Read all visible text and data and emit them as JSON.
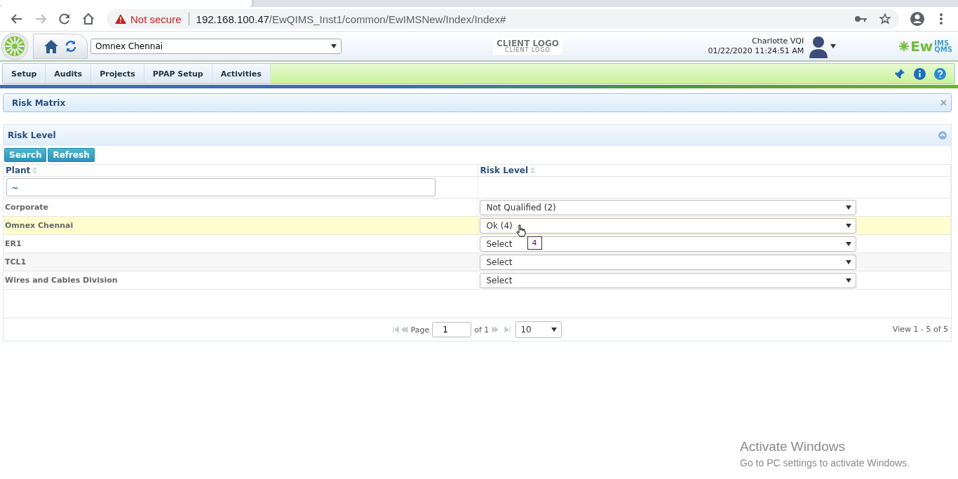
{
  "browser": {
    "security": "Not secure",
    "url_host": "192.168.100.47",
    "url_path": "/EwQIMS_Inst1/common/EwIMSNew/Index/Index#"
  },
  "header": {
    "plant": "Omnex Chennai",
    "client_logo": "CLIENT LOGO",
    "client_logo_sub": "CLIENT LOGO",
    "user": "Charlotte VQI",
    "datetime": "01/22/2020 11:24:51 AM",
    "brand": "Ew",
    "brand_sup": "IMS",
    "brand_sub": "QMS"
  },
  "nav": [
    {
      "label": "Setup"
    },
    {
      "label": "Audits"
    },
    {
      "label": "Projects"
    },
    {
      "label": "PPAP Setup"
    },
    {
      "label": "Activities"
    }
  ],
  "page_title": "Risk Matrix",
  "panel": {
    "title": "Risk Level",
    "buttons": [
      "Search",
      "Refresh"
    ],
    "columns": [
      "Plant",
      "Risk Level"
    ],
    "filter_value": "~",
    "rows": [
      {
        "plant": "Corporate",
        "risk": "Not Qualified (2)",
        "selected": false
      },
      {
        "plant": "Omnex Chennai",
        "risk": "Ok (4)",
        "selected": true
      },
      {
        "plant": "ER1",
        "risk": "Select",
        "selected": false
      },
      {
        "plant": "TCL1",
        "risk": "Select",
        "selected": false
      },
      {
        "plant": "Wires and Cables Division",
        "risk": "Select",
        "selected": false
      }
    ],
    "tooltip": "4",
    "pager": {
      "page_label": "Page",
      "page": "1",
      "of": "of 1",
      "page_size": "10",
      "view": "View 1 - 5 of 5"
    }
  },
  "os_notice": {
    "title": "Activate Windows",
    "text": "Go to PC settings to activate Windows."
  }
}
